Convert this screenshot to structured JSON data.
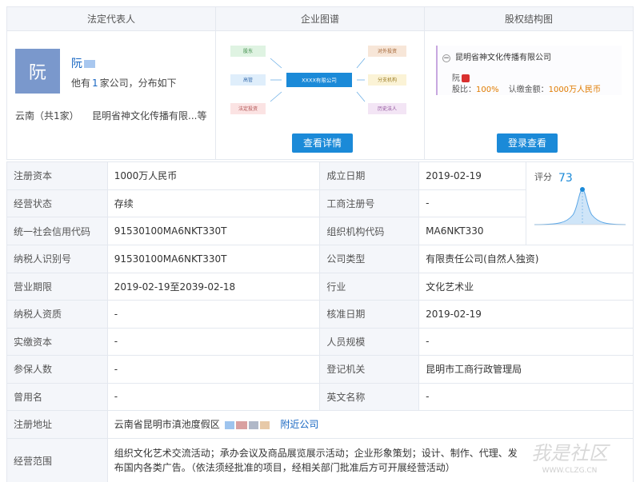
{
  "panels": {
    "legal_rep": {
      "header": "法定代表人",
      "avatar_char": "阮",
      "name": "阮",
      "desc_prefix": "他有",
      "desc_count": "1",
      "desc_suffix": "家公司，分布如下",
      "region": "云南（共1家）",
      "company": "昆明省神文化传播有限...等"
    },
    "graph": {
      "header": "企业图谱",
      "nodes": {
        "shareholder": "股东",
        "executive": "高管",
        "legal_outbound": "法定投资",
        "center": "XXXX有限公司",
        "outbound_investment": "对外投资",
        "branch": "分支机构",
        "legal_person": "历史法人"
      },
      "button": "查看详情"
    },
    "equity": {
      "header": "股权结构图",
      "company": "昆明省神文化传播有限公司",
      "holder": "阮",
      "ratio_label": "股比：",
      "ratio_value": "100%",
      "subscribed_label": "认缴金额：",
      "subscribed_value": "1000万人民币",
      "button": "登录查看"
    }
  },
  "info": {
    "score_label": "评分",
    "score_value": "73",
    "rows": [
      {
        "k1": "注册资本",
        "v1": "1000万人民币",
        "k2": "成立日期",
        "v2": "2019-02-19"
      },
      {
        "k1": "经营状态",
        "v1": "存续",
        "k2": "工商注册号",
        "v2": "-"
      },
      {
        "k1": "统一社会信用代码",
        "v1": "91530100MA6NKT330T",
        "k2": "组织机构代码",
        "v2": "MA6NKT330"
      },
      {
        "k1": "纳税人识别号",
        "v1": "91530100MA6NKT330T",
        "k2": "公司类型",
        "v2": "有限责任公司(自然人独资)"
      },
      {
        "k1": "营业期限",
        "v1": "2019-02-19至2039-02-18",
        "k2": "行业",
        "v2": "文化艺术业"
      },
      {
        "k1": "纳税人资质",
        "v1": "-",
        "k2": "核准日期",
        "v2": "2019-02-19"
      },
      {
        "k1": "实缴资本",
        "v1": "-",
        "k2": "人员规模",
        "v2": "-"
      },
      {
        "k1": "参保人数",
        "v1": "-",
        "k2": "登记机关",
        "v2": "昆明市工商行政管理局"
      },
      {
        "k1": "曾用名",
        "v1": "-",
        "k2": "英文名称",
        "v2": "-"
      }
    ],
    "address": {
      "k": "注册地址",
      "v": "云南省昆明市滇池度假区",
      "link": "附近公司"
    },
    "scope": {
      "k": "经营范围",
      "v": "组织文化艺术交流活动；承办会议及商品展览展示活动；企业形象策划；设计、制作、代理、发布国内各类广告。（依法须经批准的项目，经相关部门批准后方可开展经营活动）"
    }
  },
  "watermark": {
    "text": "我是社区",
    "url": "WWW.CLZG.CN"
  }
}
